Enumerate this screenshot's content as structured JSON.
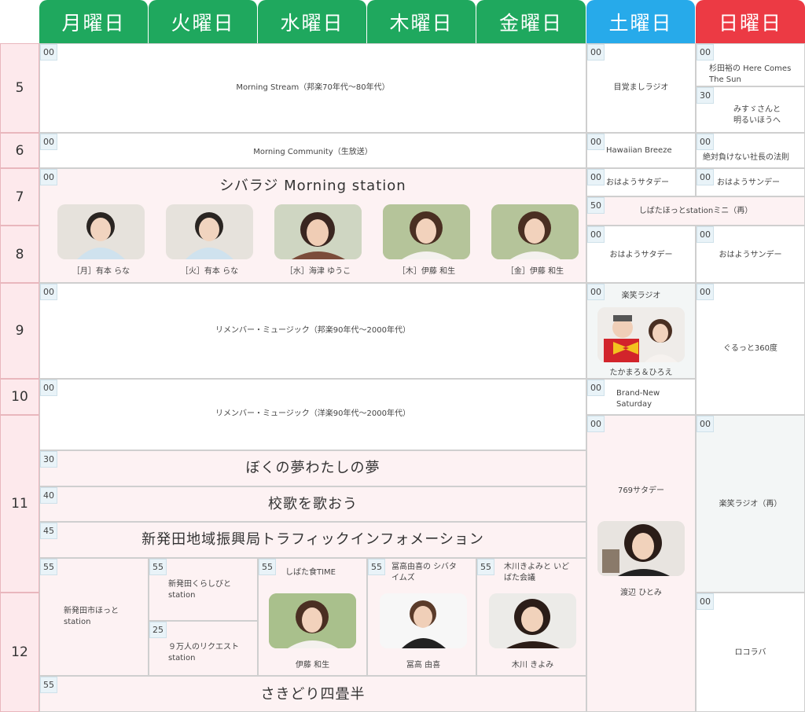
{
  "days": [
    "月曜日",
    "火曜日",
    "水曜日",
    "木曜日",
    "金曜日",
    "土曜日",
    "日曜日"
  ],
  "hours": [
    "5",
    "6",
    "7",
    "8",
    "9",
    "10",
    "11",
    "12"
  ],
  "weekday": {
    "morning_stream": {
      "min": "00",
      "title": "Morning Stream（邦楽70年代〜80年代）"
    },
    "morning_community": {
      "min": "00",
      "title": "Morning Community（生放送）"
    },
    "morning_station": {
      "min": "00",
      "title": "シバラジ Morning station",
      "hosts": [
        "［月］有本 らな",
        "［火］有本 らな",
        "［水］海津 ゆうこ",
        "［木］伊藤 和生",
        "［金］伊藤 和生"
      ]
    },
    "remember_jp": {
      "min": "00",
      "title": "リメンバー・ミュージック（邦楽90年代〜2000年代）"
    },
    "remember_en": {
      "min": "00",
      "title": "リメンバー・ミュージック（洋楽90年代〜2000年代）"
    },
    "boku": {
      "min": "30",
      "title": "ぼくの夢わたしの夢"
    },
    "kouka": {
      "min": "40",
      "title": "校歌を歌おう"
    },
    "traffic": {
      "min": "45",
      "title": "新発田地域振興局トラフィックインフォメーション"
    },
    "mon_hotto": {
      "min": "55",
      "title": "新発田市ほっと station"
    },
    "tue_kurashi": {
      "min": "55",
      "title": "新発田くらしびと station"
    },
    "tue_request": {
      "min": "25",
      "title": "９万人のリクエスト station"
    },
    "wed_food": {
      "min": "55",
      "title": "しばた食TIME",
      "host": "伊藤 和生"
    },
    "thu_times": {
      "min": "55",
      "title": "冨高由喜の シバタイムズ",
      "host": "冨高 由喜"
    },
    "fri_kaigi": {
      "min": "55",
      "title": "木川きよみと いどばた会議",
      "host": "木川 きよみ"
    },
    "sakidori": {
      "min": "55",
      "title": "さきどり四畳半"
    }
  },
  "saturday": {
    "mezamashi": {
      "min": "00",
      "title": "目覚ましラジオ"
    },
    "hawaiian": {
      "min": "00",
      "title": "Hawaiian Breeze"
    },
    "ohayo1": {
      "min": "00",
      "title": "おはようサタデー"
    },
    "mini": {
      "min": "50",
      "title": "しばたほっとstationミニ（再）"
    },
    "ohayo2": {
      "min": "00",
      "title": "おはようサタデー"
    },
    "rakusho": {
      "min": "00",
      "title": "楽笑ラジオ",
      "host": "たかまろ＆ひろえ"
    },
    "brand": {
      "min": "00",
      "title": "Brand-New Saturday"
    },
    "s769": {
      "min": "00",
      "title": "769サタデー",
      "host": "渡辺 ひとみ"
    }
  },
  "sunday": {
    "sugita": {
      "min": "00",
      "title": "杉田裕の Here Comes The Sun"
    },
    "misu": {
      "min": "30",
      "title": "みすゞさんと 明るいほうへ"
    },
    "zettai": {
      "min": "00",
      "title": "絶対負けない社長の法則"
    },
    "ohayo1": {
      "min": "00",
      "title": "おはようサンデー"
    },
    "ohayo2": {
      "min": "00",
      "title": "おはようサンデー"
    },
    "gurutto": {
      "min": "00",
      "title": "ぐるっと360度"
    },
    "rakusho": {
      "min": "00",
      "title": "楽笑ラジオ（再）"
    },
    "rokorabo": {
      "min": "00",
      "title": "ロコラバ"
    }
  },
  "colors": {
    "weekday": "#1fa85e",
    "saturday": "#27aaea",
    "sunday": "#ec3a44",
    "hour_bg": "#fde9ec",
    "pink_bg": "#fdf2f3"
  }
}
